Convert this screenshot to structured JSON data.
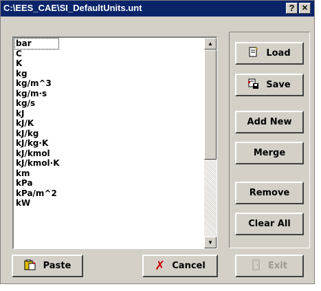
{
  "window": {
    "title": "C:\\EES_CAE\\SI_DefaultUnits.unt",
    "help_label": "?",
    "close_label": "✕"
  },
  "units_list": {
    "items": [
      "bar",
      "C",
      "K",
      "kg",
      "kg/m^3",
      "kg/m·s",
      "kg/s",
      "kJ",
      "kJ/K",
      "kJ/kg",
      "kJ/kg·K",
      "kJ/kmol",
      "kJ/kmol·K",
      "km",
      "kPa",
      "kPa/m^2",
      "kW"
    ],
    "selected": "bar"
  },
  "buttons": {
    "load": "Load",
    "save": "Save",
    "add_new": "Add New",
    "merge": "Merge",
    "remove": "Remove",
    "clear_all": "Clear All",
    "paste": "Paste",
    "cancel": "Cancel",
    "exit": "Exit"
  },
  "colors": {
    "titlebar": "#0a246a",
    "cancel_x": "#cc0000"
  }
}
